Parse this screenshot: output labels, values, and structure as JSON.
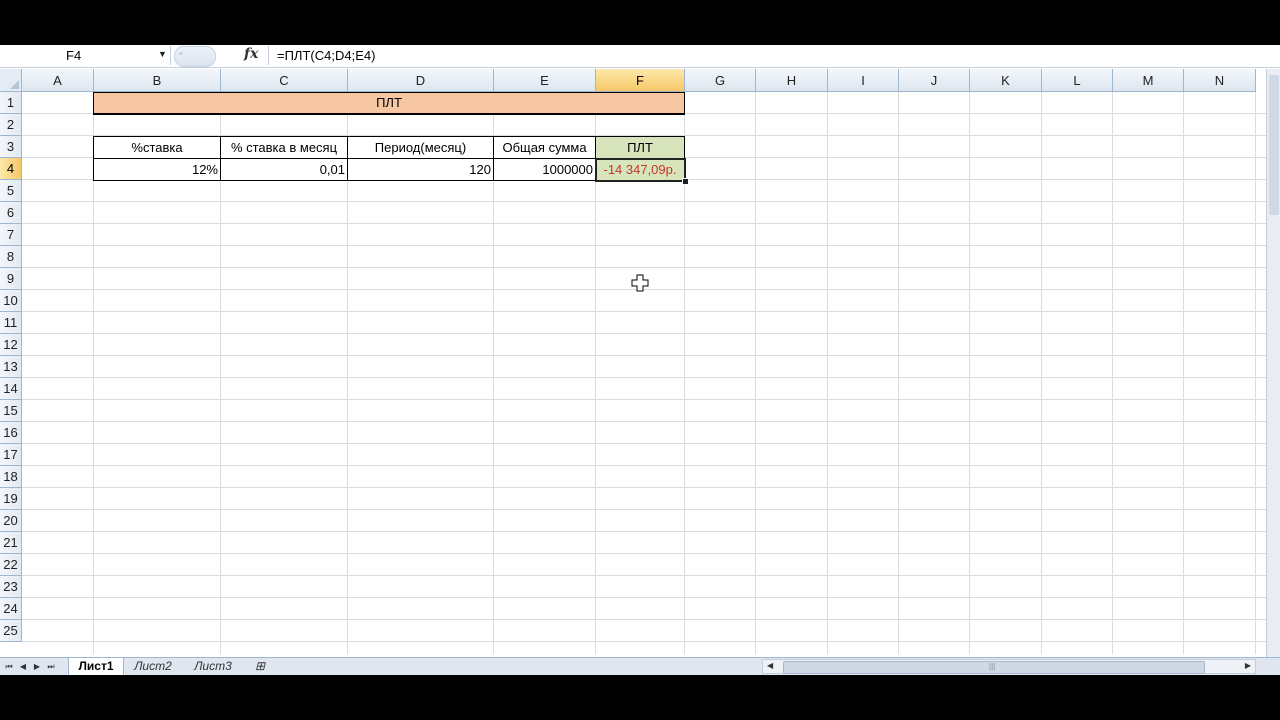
{
  "formula_bar": {
    "name_box": "F4",
    "fx_label": "fx",
    "formula": "=ПЛТ(C4;D4;E4)"
  },
  "columns": [
    "A",
    "B",
    "C",
    "D",
    "E",
    "F",
    "G",
    "H",
    "I",
    "J",
    "K",
    "L",
    "M",
    "N"
  ],
  "selected_column": "F",
  "rows": [
    "1",
    "2",
    "3",
    "4",
    "5",
    "6",
    "7",
    "8",
    "9",
    "10",
    "11",
    "12",
    "13",
    "14",
    "15",
    "16",
    "17",
    "18",
    "19",
    "20",
    "21",
    "22",
    "23",
    "24",
    "25"
  ],
  "selected_row": "4",
  "table": {
    "title": "ПЛТ",
    "headers": [
      "%ставка",
      "% ставка в месяц",
      "Период(месяц)",
      "Общая сумма",
      "ПЛТ"
    ],
    "values": [
      "12%",
      "0,01",
      "120",
      "1000000",
      "-14 347,09р."
    ]
  },
  "sheets": {
    "tabs": [
      "Лист1",
      "Лист2",
      "Лист3"
    ],
    "active": "Лист1"
  },
  "colors": {
    "title_fill": "#f7c7a3",
    "result_fill": "#d8e4bc",
    "negative_text": "#c0392b"
  }
}
